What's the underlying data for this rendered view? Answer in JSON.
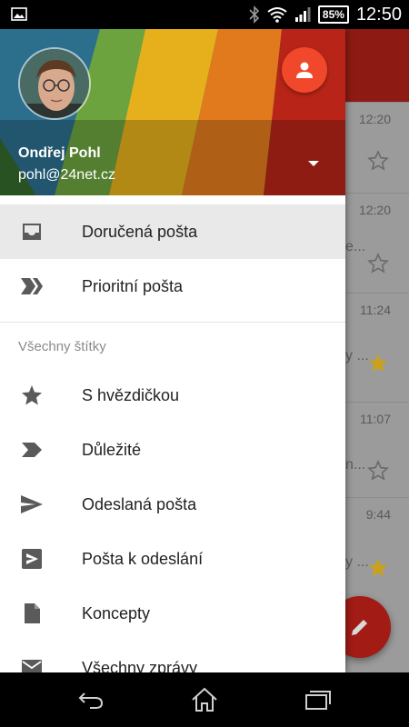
{
  "status_bar": {
    "battery": "85%",
    "time": "12:50",
    "icons": [
      "image-icon",
      "bluetooth-icon",
      "wifi-icon",
      "signal-icon",
      "battery-icon"
    ]
  },
  "account": {
    "name": "Ondřej Pohl",
    "email": "pohl@24net.cz"
  },
  "drawer": {
    "items": [
      {
        "label": "Doručená pošta",
        "icon": "inbox-icon",
        "selected": true
      },
      {
        "label": "Prioritní pošta",
        "icon": "priority-icon"
      }
    ],
    "section_label": "Všechny štítky",
    "label_items": [
      {
        "label": "S hvězdičkou",
        "icon": "star-icon"
      },
      {
        "label": "Důležité",
        "icon": "important-icon"
      },
      {
        "label": "Odeslaná pošta",
        "icon": "send-icon"
      },
      {
        "label": "Pošta k odeslání",
        "icon": "outbox-icon"
      },
      {
        "label": "Koncepty",
        "icon": "draft-icon"
      },
      {
        "label": "Všechny zprávy",
        "icon": "mail-icon"
      }
    ]
  },
  "background_list": {
    "rows": [
      {
        "time": "12:20",
        "fragment": "",
        "starred": false
      },
      {
        "time": "12:20",
        "fragment": "e...",
        "starred": false
      },
      {
        "time": "11:24",
        "fragment": "y ...",
        "starred": true
      },
      {
        "time": "11:07",
        "fragment": "n...",
        "starred": false
      },
      {
        "time": "9:44",
        "fragment": "y ...",
        "starred": true
      }
    ]
  },
  "colors": {
    "primary": "#8d1b13",
    "account_button": "#f1482c",
    "selected_bg": "#e9e9e9",
    "star_gold": "#c9a21c"
  }
}
